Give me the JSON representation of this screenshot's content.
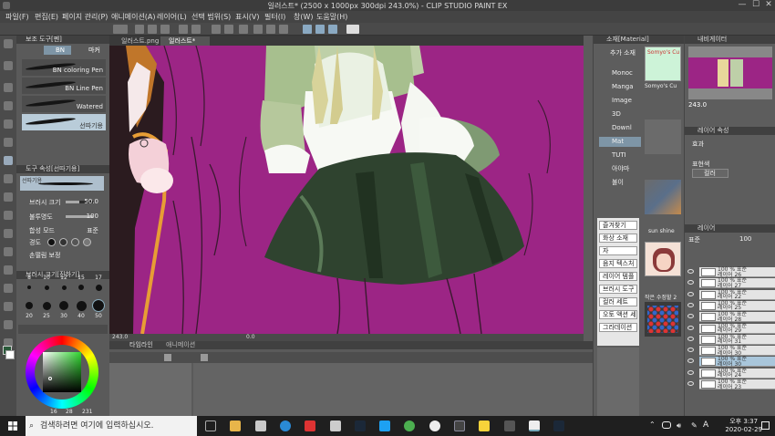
{
  "window": {
    "title": "일러스트* (2500 x 1000px 300dpi 243.0%) - CLIP STUDIO PAINT EX",
    "controls": [
      "—",
      "☐",
      "✕"
    ]
  },
  "menu": [
    "파일(F)",
    "편집(E)",
    "페이지 관리(P)",
    "애니메이션(A)",
    "레이어(L)",
    "선택 범위(S)",
    "표시(V)",
    "필터(I)",
    "창(W)",
    "도움말(H)"
  ],
  "left_panel": {
    "sub_tool_title": "보조 도구[펜]",
    "tabs": [
      "BN",
      "마커"
    ],
    "brushes": [
      {
        "name": "BN coloring Pen",
        "selected": false
      },
      {
        "name": "BN Line Pen",
        "selected": false
      },
      {
        "name": "Watered",
        "selected": false
      },
      {
        "name": "선따기용",
        "selected": true
      }
    ],
    "tool_property_title": "도구 속성[선따기용]",
    "brush_preview_label": "선따기용",
    "properties": [
      {
        "label": "브러시 크기",
        "value": "50.0",
        "fill": 0.5
      },
      {
        "label": "불투명도",
        "value": "100",
        "fill": 1.0
      },
      {
        "label": "합성 모드",
        "value": "표준"
      },
      {
        "label": "경도",
        "value": ""
      },
      {
        "label": "손떨림 보정",
        "value": ""
      }
    ],
    "brush_size_title": "브러시 크기[진하기]",
    "brush_sizes": [
      "8",
      "10",
      "12",
      "15",
      "17",
      "20",
      "25",
      "30",
      "40",
      "50"
    ],
    "color_values": [
      "16",
      "28",
      "231"
    ]
  },
  "canvas": {
    "tabs": [
      {
        "label": "일러스트.png",
        "active": false
      },
      {
        "label": "일러스트*",
        "active": true
      }
    ],
    "background": "#9c2585",
    "status": {
      "zoom": "243.0",
      "coords": "0.0"
    }
  },
  "timeline": {
    "title": "타임라인",
    "tab2": "애니메이션"
  },
  "material": {
    "title": "소재[Material]",
    "tab": "추가 소재",
    "tree": [
      {
        "label": "Monoc",
        "selected": false
      },
      {
        "label": "Manga",
        "selected": false
      },
      {
        "label": "Image",
        "selected": false
      },
      {
        "label": "3D",
        "selected": false
      },
      {
        "label": "Downl",
        "selected": false
      },
      {
        "label": "Mat",
        "selected": true
      },
      {
        "label": "TUTI",
        "selected": false
      },
      {
        "label": "아야마",
        "selected": false
      },
      {
        "label": "불이",
        "selected": false
      }
    ],
    "thumb_labels": [
      "Somyo's Cu",
      "sun shine",
      "작은 수정할 2"
    ],
    "favorites_title": "즐겨찾기",
    "list": [
      "즐겨찾기",
      "화상 소재",
      "자",
      "음지 텍스처",
      "레이어 템플",
      "브러시 도구",
      "컬러 세트",
      "오토 액션 세",
      "그라데이션"
    ]
  },
  "right": {
    "navigator_title": "내비게이터",
    "zoom": "243.0",
    "layer_prop_title": "레이어 속성",
    "effect_label": "효과",
    "express_label": "표현색",
    "color_mode": "컬러",
    "layer_title": "레이어",
    "blend": "표준",
    "opacity": "100",
    "layers": [
      {
        "pct": "100 % 표준",
        "name": "레이어 26",
        "selected": false
      },
      {
        "pct": "100 % 표준",
        "name": "레이어 27",
        "selected": false
      },
      {
        "pct": "100 % 표준",
        "name": "레이어 22",
        "selected": false
      },
      {
        "pct": "100 % 표준",
        "name": "레이어 25",
        "selected": false
      },
      {
        "pct": "100 % 표준",
        "name": "레이어 28",
        "selected": false
      },
      {
        "pct": "100 % 표준",
        "name": "레이어 29",
        "selected": false
      },
      {
        "pct": "100 % 표준",
        "name": "레이어 31",
        "selected": false
      },
      {
        "pct": "100 % 표준",
        "name": "레이어 30",
        "selected": false
      },
      {
        "pct": "100 % 표준",
        "name": "레이어 30",
        "selected": true
      },
      {
        "pct": "100 % 표준",
        "name": "레이어 24",
        "selected": false
      },
      {
        "pct": "100 % 표준",
        "name": "레이어 23",
        "selected": false
      }
    ]
  },
  "taskbar": {
    "search_placeholder": "검색하려면 여기에 입력하십시오.",
    "time": "오후 3:37",
    "date": "2020-02-29",
    "lang": "A"
  }
}
